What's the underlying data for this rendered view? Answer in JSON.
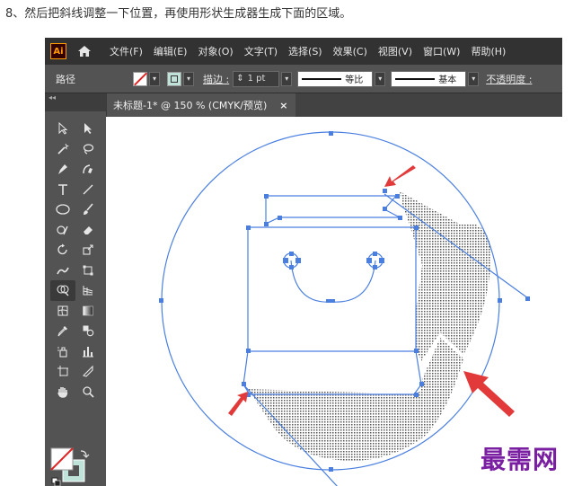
{
  "caption": "8、然后把斜线调整一下位置，再使用形状生成器生成下面的区域。",
  "app": {
    "logo_text": "Ai",
    "menus": [
      "文件(F)",
      "编辑(E)",
      "对象(O)",
      "文字(T)",
      "选择(S)",
      "效果(C)",
      "视图(V)",
      "窗口(W)",
      "帮助(H)"
    ]
  },
  "control_bar": {
    "object_label": "路径",
    "stroke_label": "描边 :",
    "stroke_weight": "1 pt",
    "profile_label": "等比",
    "brush_label": "基本",
    "opacity_label": "不透明度 :"
  },
  "document_tab": {
    "title": "未标题-1* @ 150 % (CMYK/预览)",
    "close": "×"
  },
  "toolbar": {
    "collapse_marks": "◂◂",
    "tools": [
      "selection-icon",
      "direct-selection-icon",
      "magic-wand-icon",
      "lasso-icon",
      "pen-icon",
      "curvature-icon",
      "type-icon",
      "line-segment-icon",
      "ellipse-icon",
      "paintbrush-icon",
      "shaper-icon",
      "eraser-icon",
      "rotate-icon",
      "scale-icon",
      "warp-icon",
      "free-transform-icon",
      "shape-builder-icon",
      "perspective-grid-icon",
      "mesh-icon",
      "gradient-icon",
      "eyedropper-icon",
      "blend-icon",
      "symbol-sprayer-icon",
      "column-graph-icon",
      "artboard-icon",
      "slice-icon",
      "hand-icon",
      "zoom-icon"
    ],
    "active_tool": "shape-builder-icon"
  },
  "colors": {
    "ui_dark": "#323232",
    "ui_mid": "#535353",
    "path_blue": "#4a7fe0",
    "arrow_red": "#e23a3a",
    "fill_mint": "#bfe3d9"
  },
  "watermark": "最需网"
}
